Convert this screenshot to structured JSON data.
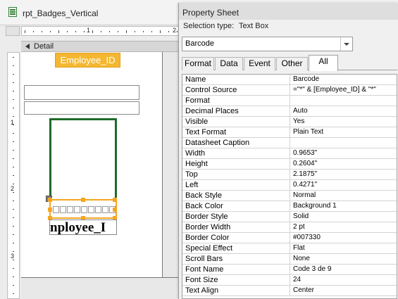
{
  "report": {
    "tab_title": "rpt_Badges_Vertical",
    "section_label": "Detail",
    "h_ruler_numbers": [
      "1",
      "2"
    ],
    "v_ruler_numbers": [
      "1",
      "2",
      "3"
    ],
    "employee_id_label": "Employee_ID",
    "barcode_text": "nployee_I",
    "colors": {
      "border_green": "#1f6b2a",
      "selection_orange": "#f5a623",
      "label_gold": "#f5b731"
    }
  },
  "property_sheet": {
    "title": "Property Sheet",
    "selection_type_label": "Selection type:",
    "selection_type_value": "Text Box",
    "object_select_value": "Barcode",
    "tabs": [
      {
        "label": "Format",
        "active": false
      },
      {
        "label": "Data",
        "active": false
      },
      {
        "label": "Event",
        "active": false
      },
      {
        "label": "Other",
        "active": false
      },
      {
        "label": "All",
        "active": true
      }
    ],
    "properties": [
      {
        "name": "Name",
        "value": "Barcode"
      },
      {
        "name": "Control Source",
        "value": "=\"*\" & [Employee_ID] & \"*\""
      },
      {
        "name": "Format",
        "value": ""
      },
      {
        "name": "Decimal Places",
        "value": "Auto"
      },
      {
        "name": "Visible",
        "value": "Yes"
      },
      {
        "name": "Text Format",
        "value": "Plain Text"
      },
      {
        "name": "Datasheet Caption",
        "value": ""
      },
      {
        "name": "Width",
        "value": "0.9653\""
      },
      {
        "name": "Height",
        "value": "0.2604\""
      },
      {
        "name": "Top",
        "value": "2.1875\""
      },
      {
        "name": "Left",
        "value": "0.4271\""
      },
      {
        "name": "Back Style",
        "value": "Normal"
      },
      {
        "name": "Back Color",
        "value": "Background 1"
      },
      {
        "name": "Border Style",
        "value": "Solid"
      },
      {
        "name": "Border Width",
        "value": "2 pt"
      },
      {
        "name": "Border Color",
        "value": "#007330"
      },
      {
        "name": "Special Effect",
        "value": "Flat"
      },
      {
        "name": "Scroll Bars",
        "value": "None"
      },
      {
        "name": "Font Name",
        "value": "Code 3 de 9"
      },
      {
        "name": "Font Size",
        "value": "24"
      },
      {
        "name": "Text Align",
        "value": "Center"
      }
    ]
  }
}
